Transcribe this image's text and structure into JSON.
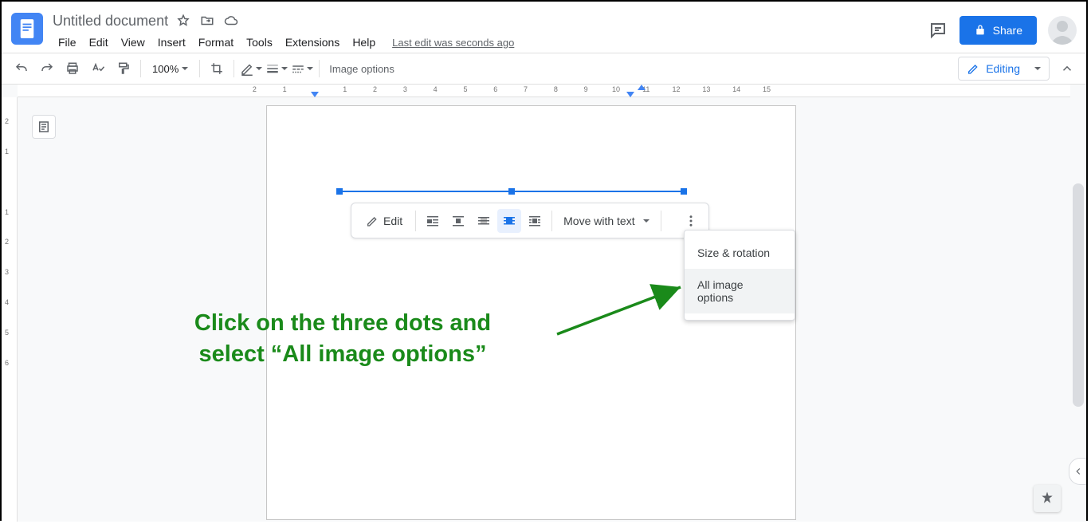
{
  "doc_title": "Untitled document",
  "menubar": {
    "file": "File",
    "edit": "Edit",
    "view": "View",
    "insert": "Insert",
    "format": "Format",
    "tools": "Tools",
    "extensions": "Extensions",
    "help": "Help"
  },
  "last_edit": "Last edit was seconds ago",
  "share_label": "Share",
  "toolbar": {
    "zoom": "100%",
    "image_options_label": "Image options",
    "editing_label": "Editing"
  },
  "ruler_h": {
    "numbers": [
      "2",
      "1",
      "1",
      "2",
      "3",
      "4",
      "5",
      "6",
      "7",
      "8",
      "9",
      "10",
      "11",
      "12",
      "13",
      "14",
      "15"
    ],
    "left_margin_at": 2.38,
    "right_margin_at": 12.85,
    "tab_at": 13.22
  },
  "ruler_v": {
    "numbers": [
      "2",
      "1",
      "1",
      "2",
      "3",
      "4",
      "5",
      "6"
    ]
  },
  "image_toolbar": {
    "edit_label": "Edit",
    "wrap_modes": [
      "inline",
      "wrap-left",
      "break",
      "wrap-center",
      "behind"
    ],
    "active_wrap_index": 3,
    "move_label": "Move with text"
  },
  "popup": {
    "items": [
      "Size & rotation",
      "All image options"
    ],
    "hover_index": 1
  },
  "annotation": {
    "line1": "Click on the three dots and",
    "line2": "select “All image options”"
  }
}
